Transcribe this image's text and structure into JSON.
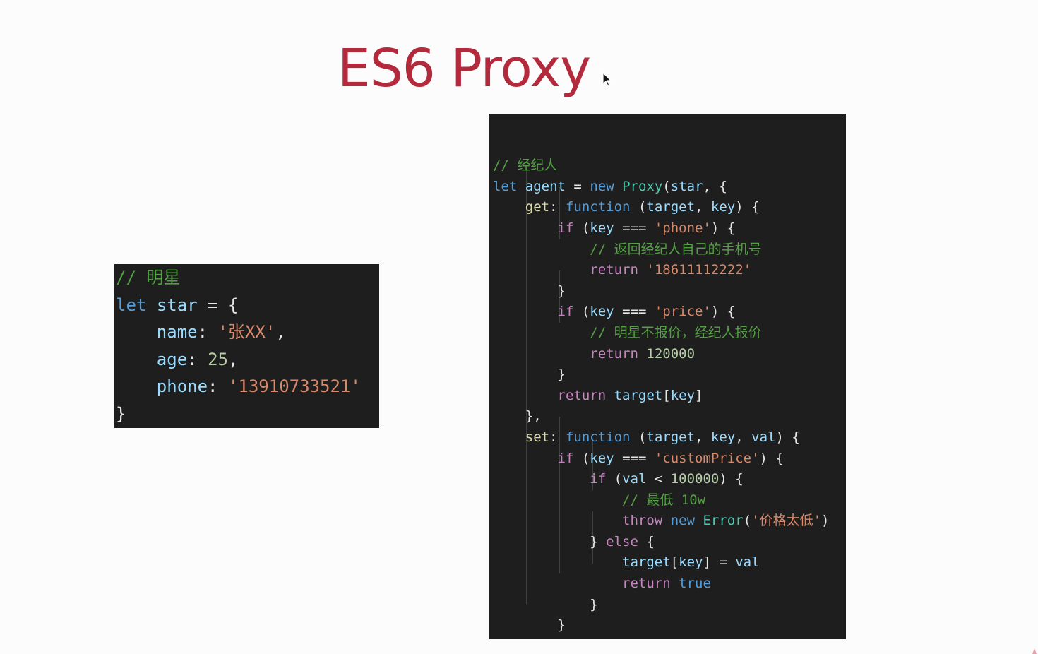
{
  "slide": {
    "title": "ES6 Proxy"
  },
  "colors": {
    "title": "#b32a3c",
    "code_background": "#1e1e1e",
    "page_background": "#fdfcfc"
  },
  "star_code": {
    "lines": [
      [
        {
          "t": "// 明星",
          "c": "comment"
        }
      ],
      [
        {
          "t": "let",
          "c": "keyword"
        },
        {
          "t": " ",
          "c": "punct"
        },
        {
          "t": "star",
          "c": "ident"
        },
        {
          "t": " = {",
          "c": "punct"
        }
      ],
      [
        {
          "t": "    ",
          "c": "punct"
        },
        {
          "t": "name",
          "c": "ident"
        },
        {
          "t": ": ",
          "c": "punct"
        },
        {
          "t": "'张XX'",
          "c": "string"
        },
        {
          "t": ",",
          "c": "punct"
        }
      ],
      [
        {
          "t": "    ",
          "c": "punct"
        },
        {
          "t": "age",
          "c": "ident"
        },
        {
          "t": ": ",
          "c": "punct"
        },
        {
          "t": "25",
          "c": "number"
        },
        {
          "t": ",",
          "c": "punct"
        }
      ],
      [
        {
          "t": "    ",
          "c": "punct"
        },
        {
          "t": "phone",
          "c": "ident"
        },
        {
          "t": ": ",
          "c": "punct"
        },
        {
          "t": "'13910733521'",
          "c": "string"
        }
      ],
      [
        {
          "t": "}",
          "c": "punct"
        }
      ]
    ]
  },
  "agent_code": {
    "lines": [
      [
        {
          "t": "// 经纪人",
          "c": "comment"
        }
      ],
      [
        {
          "t": "let",
          "c": "keyword"
        },
        {
          "t": " ",
          "c": "punct"
        },
        {
          "t": "agent",
          "c": "ident"
        },
        {
          "t": " = ",
          "c": "punct"
        },
        {
          "t": "new",
          "c": "keyword"
        },
        {
          "t": " ",
          "c": "punct"
        },
        {
          "t": "Proxy",
          "c": "class"
        },
        {
          "t": "(",
          "c": "punct"
        },
        {
          "t": "star",
          "c": "ident"
        },
        {
          "t": ", {",
          "c": "punct"
        }
      ],
      [
        {
          "t": "    ",
          "c": "punct"
        },
        {
          "t": "get",
          "c": "prop"
        },
        {
          "t": ": ",
          "c": "punct"
        },
        {
          "t": "function",
          "c": "keyword"
        },
        {
          "t": " (",
          "c": "punct"
        },
        {
          "t": "target",
          "c": "ident"
        },
        {
          "t": ", ",
          "c": "punct"
        },
        {
          "t": "key",
          "c": "ident"
        },
        {
          "t": ") {",
          "c": "punct"
        }
      ],
      [
        {
          "t": "        ",
          "c": "punct"
        },
        {
          "t": "if",
          "c": "control"
        },
        {
          "t": " (",
          "c": "punct"
        },
        {
          "t": "key",
          "c": "ident"
        },
        {
          "t": " === ",
          "c": "punct"
        },
        {
          "t": "'phone'",
          "c": "string"
        },
        {
          "t": ") {",
          "c": "punct"
        }
      ],
      [
        {
          "t": "            ",
          "c": "punct"
        },
        {
          "t": "// 返回经纪人自己的手机号",
          "c": "comment"
        }
      ],
      [
        {
          "t": "            ",
          "c": "punct"
        },
        {
          "t": "return",
          "c": "control"
        },
        {
          "t": " ",
          "c": "punct"
        },
        {
          "t": "'18611112222'",
          "c": "string"
        }
      ],
      [
        {
          "t": "        }",
          "c": "punct"
        }
      ],
      [
        {
          "t": "        ",
          "c": "punct"
        },
        {
          "t": "if",
          "c": "control"
        },
        {
          "t": " (",
          "c": "punct"
        },
        {
          "t": "key",
          "c": "ident"
        },
        {
          "t": " === ",
          "c": "punct"
        },
        {
          "t": "'price'",
          "c": "string"
        },
        {
          "t": ") {",
          "c": "punct"
        }
      ],
      [
        {
          "t": "            ",
          "c": "punct"
        },
        {
          "t": "// 明星不报价，经纪人报价",
          "c": "comment"
        }
      ],
      [
        {
          "t": "            ",
          "c": "punct"
        },
        {
          "t": "return",
          "c": "control"
        },
        {
          "t": " ",
          "c": "punct"
        },
        {
          "t": "120000",
          "c": "number"
        }
      ],
      [
        {
          "t": "        }",
          "c": "punct"
        }
      ],
      [
        {
          "t": "        ",
          "c": "punct"
        },
        {
          "t": "return",
          "c": "control"
        },
        {
          "t": " ",
          "c": "punct"
        },
        {
          "t": "target",
          "c": "ident"
        },
        {
          "t": "[",
          "c": "punct"
        },
        {
          "t": "key",
          "c": "ident"
        },
        {
          "t": "]",
          "c": "punct"
        }
      ],
      [
        {
          "t": "    },",
          "c": "punct"
        }
      ],
      [
        {
          "t": "    ",
          "c": "punct"
        },
        {
          "t": "set",
          "c": "prop"
        },
        {
          "t": ": ",
          "c": "punct"
        },
        {
          "t": "function",
          "c": "keyword"
        },
        {
          "t": " (",
          "c": "punct"
        },
        {
          "t": "target",
          "c": "ident"
        },
        {
          "t": ", ",
          "c": "punct"
        },
        {
          "t": "key",
          "c": "ident"
        },
        {
          "t": ", ",
          "c": "punct"
        },
        {
          "t": "val",
          "c": "ident"
        },
        {
          "t": ") {",
          "c": "punct"
        }
      ],
      [
        {
          "t": "        ",
          "c": "punct"
        },
        {
          "t": "if",
          "c": "control"
        },
        {
          "t": " (",
          "c": "punct"
        },
        {
          "t": "key",
          "c": "ident"
        },
        {
          "t": " === ",
          "c": "punct"
        },
        {
          "t": "'customPrice'",
          "c": "string"
        },
        {
          "t": ") {",
          "c": "punct"
        }
      ],
      [
        {
          "t": "            ",
          "c": "punct"
        },
        {
          "t": "if",
          "c": "control"
        },
        {
          "t": " (",
          "c": "punct"
        },
        {
          "t": "val",
          "c": "ident"
        },
        {
          "t": " < ",
          "c": "punct"
        },
        {
          "t": "100000",
          "c": "number"
        },
        {
          "t": ") {",
          "c": "punct"
        }
      ],
      [
        {
          "t": "                ",
          "c": "punct"
        },
        {
          "t": "// 最低 10w",
          "c": "comment"
        }
      ],
      [
        {
          "t": "                ",
          "c": "punct"
        },
        {
          "t": "throw",
          "c": "control"
        },
        {
          "t": " ",
          "c": "punct"
        },
        {
          "t": "new",
          "c": "keyword"
        },
        {
          "t": " ",
          "c": "punct"
        },
        {
          "t": "Error",
          "c": "class"
        },
        {
          "t": "(",
          "c": "punct"
        },
        {
          "t": "'价格太低'",
          "c": "string"
        },
        {
          "t": ")",
          "c": "punct"
        }
      ],
      [
        {
          "t": "            } ",
          "c": "punct"
        },
        {
          "t": "else",
          "c": "control"
        },
        {
          "t": " {",
          "c": "punct"
        }
      ],
      [
        {
          "t": "                ",
          "c": "punct"
        },
        {
          "t": "target",
          "c": "ident"
        },
        {
          "t": "[",
          "c": "punct"
        },
        {
          "t": "key",
          "c": "ident"
        },
        {
          "t": "] = ",
          "c": "punct"
        },
        {
          "t": "val",
          "c": "ident"
        }
      ],
      [
        {
          "t": "                ",
          "c": "punct"
        },
        {
          "t": "return",
          "c": "control"
        },
        {
          "t": " ",
          "c": "punct"
        },
        {
          "t": "true",
          "c": "keyword"
        }
      ],
      [
        {
          "t": "            }",
          "c": "punct"
        }
      ],
      [
        {
          "t": "        }",
          "c": "punct"
        }
      ],
      [
        {
          "t": "    }",
          "c": "punct"
        }
      ],
      [
        {
          "t": "})",
          "c": "punct"
        }
      ]
    ]
  }
}
